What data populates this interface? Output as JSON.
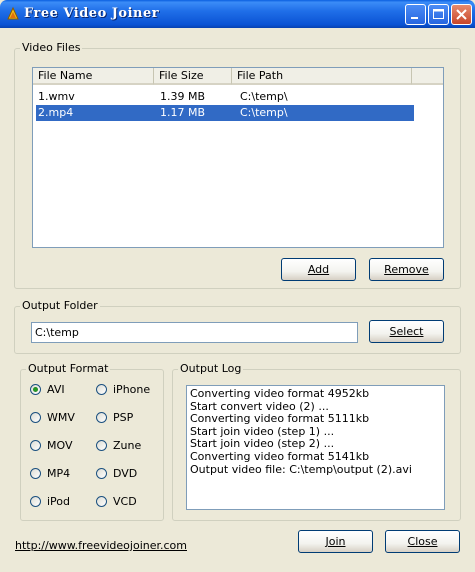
{
  "window": {
    "title": "Free Video Joiner"
  },
  "video_files": {
    "label": "Video Files",
    "columns": [
      "File Name",
      "File Size",
      "File Path"
    ],
    "rows": [
      {
        "name": "1.wmv",
        "size": "1.39 MB",
        "path": "C:\\temp\\",
        "selected": false
      },
      {
        "name": "2.mp4",
        "size": "1.17 MB",
        "path": "C:\\temp\\",
        "selected": true
      }
    ],
    "add_label": "Add",
    "remove_label": "Remove"
  },
  "output_folder": {
    "label": "Output Folder",
    "value": "C:\\temp",
    "select_label": "Select"
  },
  "output_format": {
    "label": "Output Format",
    "options": [
      "AVI",
      "iPhone",
      "WMV",
      "PSP",
      "MOV",
      "Zune",
      "MP4",
      "DVD",
      "iPod",
      "VCD"
    ],
    "selected": "AVI"
  },
  "output_log": {
    "label": "Output Log",
    "lines": [
      "Converting video format 4952kb",
      "Start convert video (2) ...",
      "Converting video format 5111kb",
      "Start join video (step 1) ...",
      "Start join video (step 2) ...",
      "Converting video format 5141kb",
      "Output video file: C:\\temp\\output (2).avi"
    ]
  },
  "footer": {
    "link": "http://www.freevideojoiner.com",
    "join_label": "Join",
    "close_label": "Close"
  },
  "colors": {
    "selection": "#316ac5",
    "titlebar": "#0b53d4",
    "window_bg": "#ece9d8"
  }
}
